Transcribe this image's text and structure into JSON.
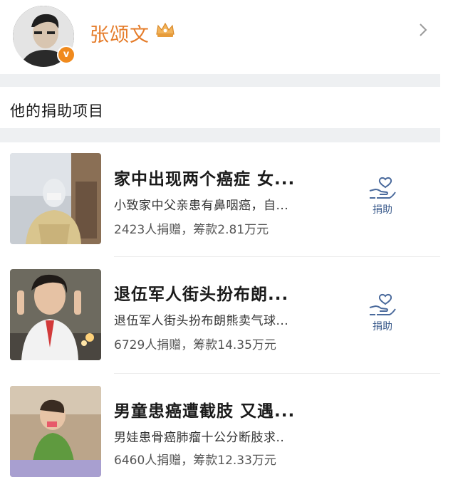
{
  "profile": {
    "name": "张颂文",
    "verified_badge": "v",
    "icons": [
      "avatar",
      "verified-icon",
      "crown-icon",
      "chevron-right-icon"
    ]
  },
  "section": {
    "title": "他的捐助项目"
  },
  "projects": [
    {
      "title": "家中出现两个癌症 女...",
      "description": "小致家中父亲患有鼻咽癌，自...",
      "stats": "2423人捐赠，筹款2.81万元",
      "action": "捐助"
    },
    {
      "title": "退伍军人街头扮布朗...",
      "description": "退伍军人街头扮布朗熊卖气球...",
      "stats": "6729人捐赠，筹款14.35万元",
      "action": "捐助"
    },
    {
      "title": "男童患癌遭截肢 又遇...",
      "description": "男娃患骨癌肺瘤十公分断肢求..",
      "stats": "6460人捐赠，筹款12.33万元",
      "action": ""
    }
  ],
  "colors": {
    "name": "#e57c2a",
    "badge": "#f08a1d",
    "action": "#3b5b8c",
    "divider": "#eef0f2"
  }
}
